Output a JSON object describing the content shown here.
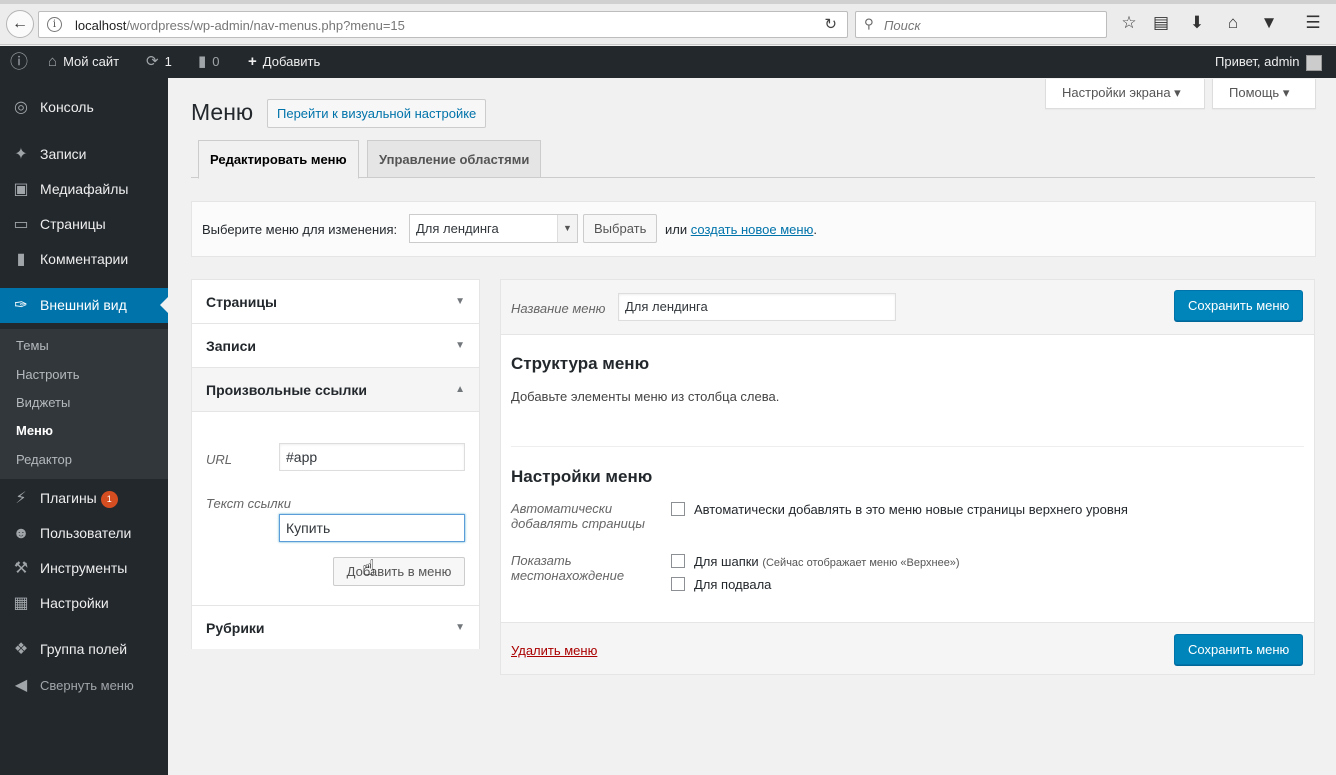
{
  "browser": {
    "url_host": "localhost",
    "url_path": "/wordpress/wp-admin/nav-menus.php?menu=15",
    "search_placeholder": "Поиск"
  },
  "adminbar": {
    "site_name": "Мой сайт",
    "updates_count": "1",
    "comments_count": "0",
    "add_label": "Добавить",
    "greeting": "Привет, admin"
  },
  "sidebar": {
    "items": [
      {
        "label": "Консоль",
        "icon": "dashboard-icon"
      },
      {
        "label": "Записи",
        "icon": "pin-icon"
      },
      {
        "label": "Медиафайлы",
        "icon": "media-icon"
      },
      {
        "label": "Страницы",
        "icon": "page-icon"
      },
      {
        "label": "Комментарии",
        "icon": "comment-icon"
      },
      {
        "label": "Внешний вид",
        "icon": "brush-icon"
      }
    ],
    "submenu": [
      "Темы",
      "Настроить",
      "Виджеты",
      "Меню",
      "Редактор"
    ],
    "items2": [
      {
        "label": "Плагины",
        "badge": "1"
      },
      {
        "label": "Пользователи"
      },
      {
        "label": "Инструменты"
      },
      {
        "label": "Настройки"
      },
      {
        "label": "Группа полей"
      },
      {
        "label": "Свернуть меню"
      }
    ]
  },
  "screen_options": "Настройки экрана",
  "help": "Помощь",
  "page": {
    "title": "Меню",
    "visual_button": "Перейти к визуальной настройке",
    "tabs": [
      "Редактировать меню",
      "Управление областями"
    ]
  },
  "select_menu": {
    "label": "Выберите меню для изменения:",
    "selected": "Для лендинга",
    "button": "Выбрать",
    "or_text": "или",
    "create_link": "создать новое меню",
    "period": "."
  },
  "accordion": {
    "pages": "Страницы",
    "posts": "Записи",
    "custom_links": "Произвольные ссылки",
    "url_label": "URL",
    "url_value": "#app",
    "text_label": "Текст ссылки",
    "text_value": "Купить",
    "add_button": "Добавить в меню",
    "categories": "Рубрики"
  },
  "menu_edit": {
    "name_label": "Название меню",
    "name_value": "Для лендинга",
    "save_button": "Сохранить меню",
    "structure_title": "Структура меню",
    "structure_hint": "Добавьте элементы меню из столбца слева.",
    "settings_title": "Настройки меню",
    "auto_add_label_1": "Автоматически",
    "auto_add_label_2": "добавлять страницы",
    "auto_add_option": "Автоматически добавлять в это меню новые страницы верхнего уровня",
    "location_label_1": "Показать",
    "location_label_2": "местонахождение",
    "loc_header": "Для шапки",
    "loc_header_note": "(Сейчас отображает меню «Верхнее»)",
    "loc_footer": "Для подвала",
    "delete_link": "Удалить меню"
  }
}
